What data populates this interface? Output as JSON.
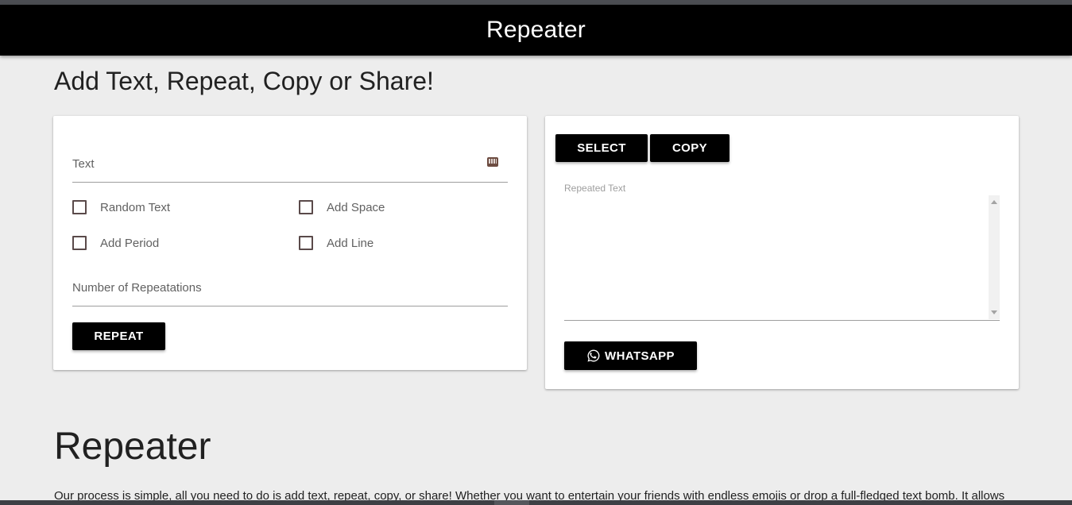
{
  "navbar": {
    "brand": "Repeater"
  },
  "page": {
    "heading": "Add Text, Repeat, Copy or Share!"
  },
  "form": {
    "text_label": "Text",
    "checkboxes": {
      "random_text": "Random Text",
      "add_space": "Add Space",
      "add_period": "Add Period",
      "add_line": "Add Line"
    },
    "repeat_count_label": "Number of Repeatations",
    "repeat_button": "REPEAT"
  },
  "output": {
    "select_button": "SELECT",
    "copy_button": "COPY",
    "repeated_text_label": "Repeated Text",
    "whatsapp_button": "WHATSAPP"
  },
  "about": {
    "title": "Repeater",
    "description": "Our process is simple, all you need to do is add text, repeat, copy, or share! Whether you want to entertain your friends with endless emojis or drop a full-fledged text bomb. It allows"
  },
  "icons": {
    "keyboard": "keyboard-icon",
    "whatsapp": "whatsapp-icon"
  },
  "colors": {
    "navbar_bg": "#000000",
    "page_bg": "#ededed",
    "button_bg": "#000000",
    "checkbox_border": "#5a4a4a"
  }
}
